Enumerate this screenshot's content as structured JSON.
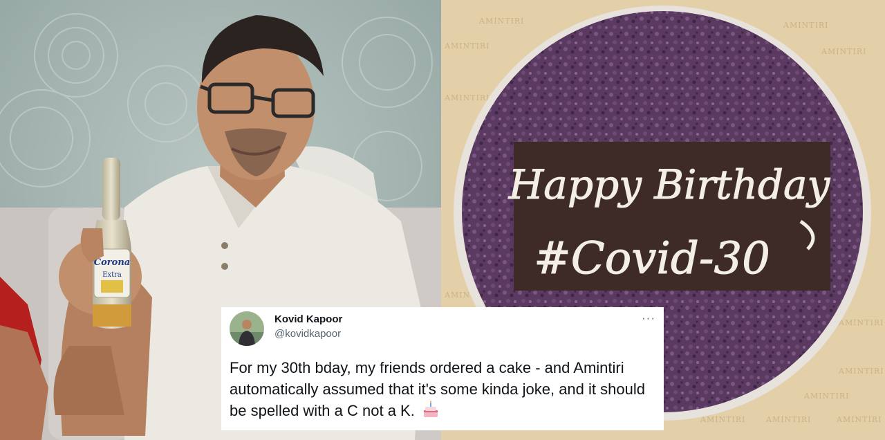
{
  "tweet": {
    "name": "Kovid Kapoor",
    "handle": "@kovidkapoor",
    "more": "···",
    "text": "For my 30th bday, my friends ordered a cake - and Amintiri automatically assumed that it's some kinda joke, and it should be spelled with a C not a K.",
    "emoji": "birthday-cake-icon"
  },
  "photo_left": {
    "bottle_label": "Corona",
    "bottle_sublabel": "Extra"
  },
  "photo_right": {
    "cake_line1": "Happy Birthday",
    "cake_line2": "#Covid-30",
    "box_brand": "AMINTIRI"
  },
  "colors": {
    "cake": "#5a3a60",
    "plaque": "#3e2a26",
    "box": "#e3cfa8",
    "wall": "#a9b9b6",
    "shirt": "#ece9e2"
  }
}
